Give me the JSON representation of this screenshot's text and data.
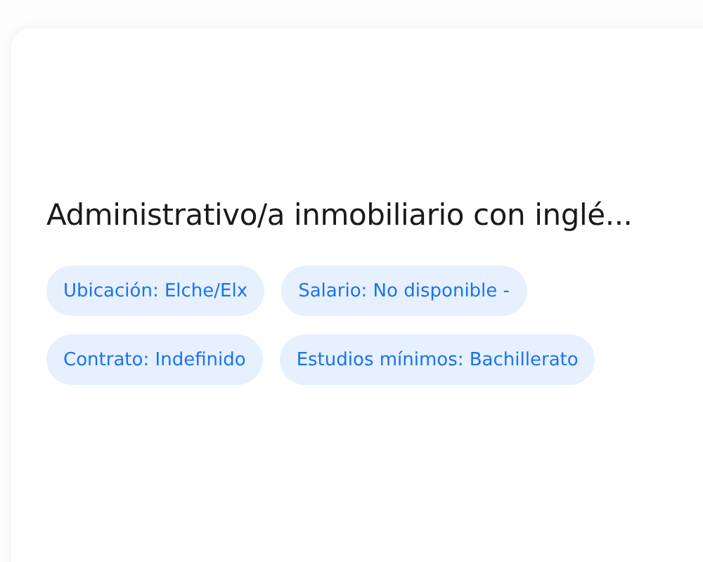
{
  "card": {
    "title": "Administrativo/a inmobiliario con inglé...",
    "tags": [
      {
        "label": "Ubicación: Elche/Elx"
      },
      {
        "label": "Salario: No disponible -"
      },
      {
        "label": "Contrato: Indefinido"
      },
      {
        "label": "Estudios mínimos: Bachillerato"
      }
    ]
  }
}
